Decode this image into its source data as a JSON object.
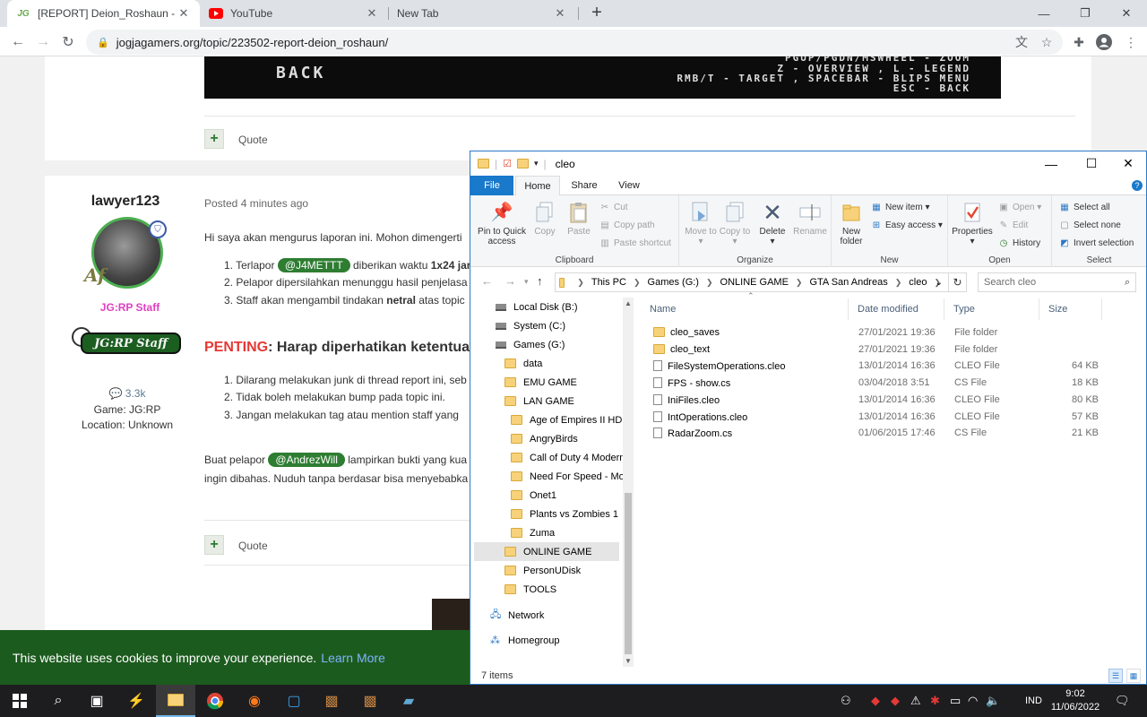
{
  "browser": {
    "tabs": [
      {
        "label": "[REPORT] Deion_Roshaun - Playe",
        "favicon": "JG"
      },
      {
        "label": "YouTube"
      },
      {
        "label": "New Tab"
      }
    ],
    "url": "jogjagamers.org/topic/223502-report-deion_roshaun/"
  },
  "forum": {
    "banner": {
      "back": "BACK",
      "lines": [
        "PGUP/PGDN/MSWHEEL - ZOOM",
        "Z - OVERVIEW , L - LEGEND",
        "RMB/T - TARGET , SPACEBAR - BLIPS MENU",
        "ESC - BACK"
      ]
    },
    "quote_label": "Quote",
    "post": {
      "author": "lawyer123",
      "avatar_mark": "Af",
      "title": "JG:RP Staff",
      "staff_badge": "JG:RP Staff",
      "views": "3.3k",
      "game": "Game: JG:RP",
      "location": "Location: Unknown",
      "posted": "Posted 4 minutes ago",
      "intro": "Hi saya akan mengurus laporan ini. Mohon dimengerti",
      "list1": [
        {
          "pre": "Terlapor ",
          "mention": "@J4METTT",
          "post": " diberikan waktu ",
          "bold": "1x24 jar"
        },
        {
          "pre": "Pelapor dipersilahkan menunggu hasil penjelasa"
        },
        {
          "pre": "Staff akan mengambil tindakan ",
          "bold": "netral",
          "post": " atas topic"
        }
      ],
      "important_label": "PENTING",
      "important_rest": ": Harap diperhatikan ketentua",
      "list2": [
        "Dilarang melakukan junk di thread report ini, seb",
        "Tidak boleh melakukan bump pada topic ini.",
        "Jangan melakukan tag atau mention staff yang"
      ],
      "closing_pre": "Buat pelapor ",
      "closing_mention": "@AndrezWill",
      "closing_post": " lampirkan bukti yang kua",
      "closing_line2": "ingin dibahas. Nuduh tanpa berdasar bisa menyebabka"
    },
    "cookie": {
      "text": "This website uses cookies to improve your experience.",
      "link": "Learn More"
    }
  },
  "explorer": {
    "title": "cleo",
    "tabs": [
      "File",
      "Home",
      "Share",
      "View"
    ],
    "ribbon": {
      "clipboard": {
        "label": "Clipboard",
        "pin": "Pin to Quick access",
        "copy": "Copy",
        "paste": "Paste",
        "cut": "Cut",
        "copy_path": "Copy path",
        "paste_shortcut": "Paste shortcut"
      },
      "organize": {
        "label": "Organize",
        "move_to": "Move to",
        "copy_to": "Copy to",
        "delete": "Delete",
        "rename": "Rename"
      },
      "new": {
        "label": "New",
        "new_folder": "New folder",
        "new_item": "New item",
        "easy_access": "Easy access"
      },
      "open": {
        "label": "Open",
        "properties": "Properties",
        "open": "Open",
        "edit": "Edit",
        "history": "History"
      },
      "select": {
        "label": "Select",
        "select_all": "Select all",
        "select_none": "Select none",
        "invert": "Invert selection"
      }
    },
    "path": [
      "This PC",
      "Games (G:)",
      "ONLINE GAME",
      "GTA San Andreas",
      "cleo"
    ],
    "search_placeholder": "Search cleo",
    "nav": {
      "local_disk": "Local Disk (B:)",
      "system": "System (C:)",
      "games": "Games (G:)",
      "folders": [
        "data",
        "EMU GAME",
        "LAN GAME"
      ],
      "lan_sub": [
        "Age of Empires II HD",
        "AngryBirds",
        "Call of Duty 4 Modern",
        "Need For Speed - Most",
        "Onet1",
        "Plants vs Zombies 1",
        "Zuma"
      ],
      "folders2": [
        "ONLINE GAME",
        "PersonUDisk",
        "TOOLS"
      ],
      "network": "Network",
      "homegroup": "Homegroup"
    },
    "columns": [
      "Name",
      "Date modified",
      "Type",
      "Size"
    ],
    "files": [
      {
        "name": "cleo_saves",
        "date": "27/01/2021 19:36",
        "type": "File folder",
        "size": "",
        "kind": "folder"
      },
      {
        "name": "cleo_text",
        "date": "27/01/2021 19:36",
        "type": "File folder",
        "size": "",
        "kind": "folder"
      },
      {
        "name": "FileSystemOperations.cleo",
        "date": "13/01/2014 16:36",
        "type": "CLEO File",
        "size": "64 KB",
        "kind": "file"
      },
      {
        "name": "FPS - show.cs",
        "date": "03/04/2018 3:51",
        "type": "CS File",
        "size": "18 KB",
        "kind": "file"
      },
      {
        "name": "IniFiles.cleo",
        "date": "13/01/2014 16:36",
        "type": "CLEO File",
        "size": "80 KB",
        "kind": "file"
      },
      {
        "name": "IntOperations.cleo",
        "date": "13/01/2014 16:36",
        "type": "CLEO File",
        "size": "57 KB",
        "kind": "file"
      },
      {
        "name": "RadarZoom.cs",
        "date": "01/06/2015 17:46",
        "type": "CS File",
        "size": "21 KB",
        "kind": "file"
      }
    ],
    "status": "7 items"
  },
  "taskbar": {
    "lang": "IND",
    "time": "9:02",
    "date": "11/06/2022"
  }
}
